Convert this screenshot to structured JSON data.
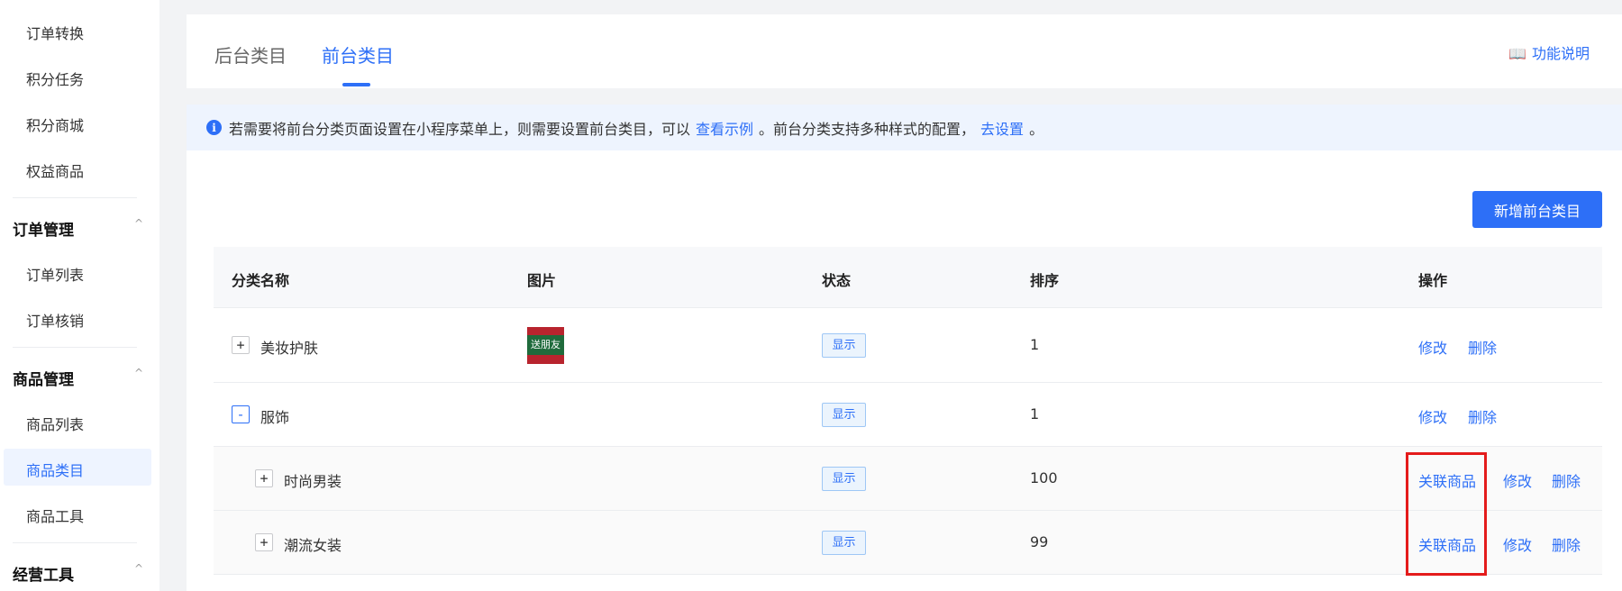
{
  "sidebar": {
    "top_items": [
      "订单转换",
      "积分任务",
      "积分商城",
      "权益商品"
    ],
    "groups": [
      {
        "label": "订单管理",
        "items": [
          "订单列表",
          "订单核销"
        ]
      },
      {
        "label": "商品管理",
        "items": [
          "商品列表",
          "商品类目",
          "商品工具"
        ]
      },
      {
        "label": "经营工具"
      }
    ],
    "active_item": "商品类目",
    "chevron": "^"
  },
  "tabs": {
    "items": [
      "后台类目",
      "前台类目"
    ],
    "active": "前台类目"
  },
  "help": {
    "icon": "book-icon",
    "label": "功能说明"
  },
  "notice": {
    "icon": "info-icon",
    "text1": "若需要将前台分类页面设置在小程序菜单上，则需要设置前台类目，可以",
    "link1": "查看示例",
    "text2": "。前台分类支持多种样式的配置，",
    "link2": "去设置",
    "text3": "。"
  },
  "add_button": "新增前台类目",
  "table": {
    "columns": [
      "分类名称",
      "图片",
      "状态",
      "排序",
      "操作"
    ],
    "rows": [
      {
        "expander": "+",
        "name": "美妆护肤",
        "image_text": "送朋友",
        "status": "显示",
        "sort": "1",
        "ops": [
          "修改",
          "删除"
        ]
      },
      {
        "expander": "-",
        "name": "服饰",
        "status": "显示",
        "sort": "1",
        "ops": [
          "修改",
          "删除"
        ]
      },
      {
        "expander": "+",
        "name": "时尚男装",
        "status": "显示",
        "sort": "100",
        "ops": [
          "关联商品",
          "修改",
          "删除"
        ]
      },
      {
        "expander": "+",
        "name": "潮流女装",
        "status": "显示",
        "sort": "99",
        "ops": [
          "关联商品",
          "修改",
          "删除"
        ]
      }
    ]
  },
  "colors": {
    "accent": "#2d6ff7",
    "highlight": "#e41b1b"
  }
}
